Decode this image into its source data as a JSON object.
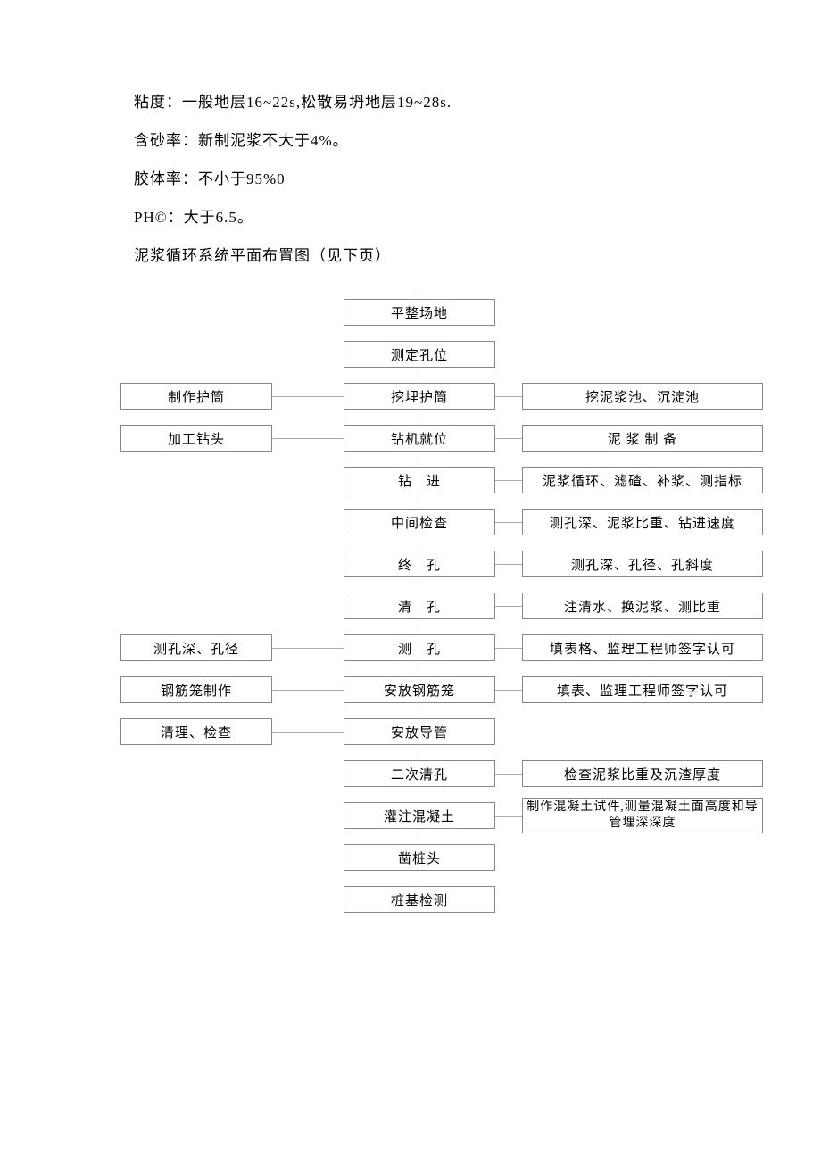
{
  "text_lines": [
    "粘度：一般地层16~22s,松散易坍地层19~28s.",
    "含砂率：新制泥浆不大于4%。",
    "胶体率：不小于95%0",
    "PH©：大于6.5。",
    "泥浆循环系统平面布置图（见下页）"
  ],
  "chart_data": {
    "type": "flowchart",
    "title": "",
    "rows": [
      {
        "left": null,
        "center": "平整场地",
        "right": null
      },
      {
        "left": null,
        "center": "测定孔位",
        "right": null
      },
      {
        "left": "制作护筒",
        "center": "挖埋护筒",
        "right": "挖泥浆池、沉淀池"
      },
      {
        "left": "加工钻头",
        "center": "钻机就位",
        "right": "泥 浆 制 备"
      },
      {
        "left": null,
        "center": "钻　进",
        "right": "泥浆循环、滤碴、补浆、测指标"
      },
      {
        "left": null,
        "center": "中间检查",
        "right": "测孔深、泥浆比重、钻进速度"
      },
      {
        "left": null,
        "center": "终　孔",
        "right": "测孔深、孔径、孔斜度"
      },
      {
        "left": null,
        "center": "清　孔",
        "right": "注清水、换泥浆、测比重"
      },
      {
        "left": "测孔深、孔径",
        "center": "测　孔",
        "right": "填表格、监理工程师签字认可"
      },
      {
        "left": "钢筋笼制作",
        "center": "安放钢筋笼",
        "right": "填表、监理工程师签字认可"
      },
      {
        "left": "清理、检查",
        "center": "安放导管",
        "right": null
      },
      {
        "left": null,
        "center": "二次清孔",
        "right": "检查泥浆比重及沉渣厚度"
      },
      {
        "left": null,
        "center": "灌注混凝土",
        "right": "制作混凝土试件,测量混凝土面高度和导管埋深深度",
        "right_tall": true
      },
      {
        "left": null,
        "center": "凿桩头",
        "right": null
      },
      {
        "left": null,
        "center": "桩基检测",
        "right": null
      }
    ]
  }
}
